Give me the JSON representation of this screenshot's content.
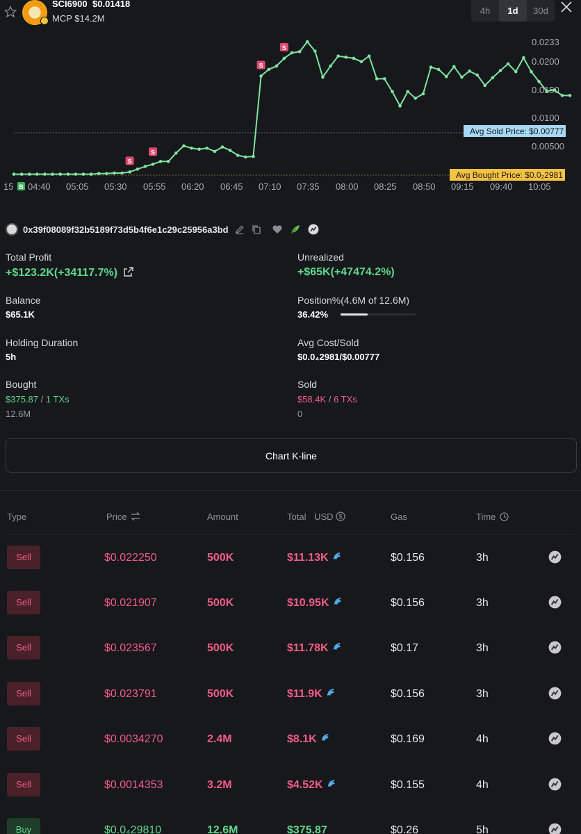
{
  "header": {
    "token_name": "SCI6900",
    "token_price": "$0.01418",
    "mcp": "MCP $14.2M",
    "timeframes": [
      "4h",
      "1d",
      "30d"
    ],
    "active_timeframe": "1d"
  },
  "chart_data": {
    "type": "line",
    "x_ticks": [
      "15",
      "04:40",
      "05:05",
      "05:30",
      "05:55",
      "06:20",
      "06:45",
      "07:10",
      "07:35",
      "08:00",
      "08:25",
      "08:50",
      "09:15",
      "09:40",
      "10:05"
    ],
    "y_ticks": [
      "0.0233",
      "0.0200",
      "0.0150",
      "0.0100",
      "0.00500"
    ],
    "series": [
      {
        "values": [
          0.0003,
          0.0003,
          0.0003,
          0.0003,
          0.0003,
          0.0003,
          0.0003,
          0.0003,
          0.0003,
          0.0003,
          0.0003,
          0.0004,
          0.0004,
          0.0005,
          0.0005,
          0.0007,
          0.0012,
          0.0017,
          0.0021,
          0.0026,
          0.0026,
          0.0041,
          0.0054,
          0.005,
          0.0048,
          0.005,
          0.0044,
          0.0052,
          0.0046,
          0.0037,
          0.0034,
          0.0035,
          0.018,
          0.0192,
          0.0198,
          0.0212,
          0.0222,
          0.0224,
          0.0242,
          0.0225,
          0.0178,
          0.0198,
          0.0216,
          0.0214,
          0.0212,
          0.0206,
          0.0216,
          0.0175,
          0.0175,
          0.0152,
          0.0126,
          0.0152,
          0.014,
          0.0148,
          0.0196,
          0.0192,
          0.0179,
          0.0197,
          0.0178,
          0.0189,
          0.0182,
          0.0163,
          0.0177,
          0.019,
          0.0202,
          0.0188,
          0.0213,
          0.0188,
          0.017,
          0.0153,
          0.0155,
          0.0145,
          0.0145
        ]
      }
    ],
    "sell_markers": [
      "S",
      "S",
      "S",
      "S"
    ],
    "buy_marker": "B",
    "avg_sold_label": "Avg Sold Price: $0.00777",
    "avg_bought_label": "Avg Bought Price: $0.0₂2981",
    "avg_sold_value": 0.00777,
    "avg_bought_value": 0.0003
  },
  "wallet": {
    "address": "0x39f08089f32b5189f73d5b4f6e1c29c25956a3bd"
  },
  "stats": {
    "total_profit_label": "Total Profit",
    "total_profit": "+$123.2K(+34117.7%)",
    "unrealized_label": "Unrealized",
    "unrealized": "+$65K(+47474.2%)",
    "balance_label": "Balance",
    "balance": "$65.1K",
    "position_label": "Position%(4.6M of 12.6M)",
    "position": "36.42%",
    "position_fraction": 0.3642,
    "holding_label": "Holding Duration",
    "holding": "5h",
    "avg_cost_label": "Avg Cost/Sold",
    "avg_cost": "$0.0₄2981/$0.00777",
    "bought_label": "Bought",
    "bought_usd": "$375.87",
    "bought_sep": "/",
    "bought_txs": "1 TXs",
    "bought_amount": "12.6M",
    "sold_label": "Sold",
    "sold_usd": "$58.4K",
    "sold_sep": "/",
    "sold_txs": "6 TXs",
    "sold_amount": "0"
  },
  "kline_button": "Chart K-line",
  "table": {
    "headers": {
      "type": "Type",
      "price": "Price",
      "amount": "Amount",
      "total": "Total",
      "usd": "USD",
      "gas": "Gas",
      "time": "Time"
    },
    "rows": [
      {
        "type": "Sell",
        "price": "$0.022250",
        "amount": "500K",
        "total": "$11.13K",
        "gas": "$0.156",
        "time": "3h"
      },
      {
        "type": "Sell",
        "price": "$0.021907",
        "amount": "500K",
        "total": "$10.95K",
        "gas": "$0.156",
        "time": "3h"
      },
      {
        "type": "Sell",
        "price": "$0.023567",
        "amount": "500K",
        "total": "$11.78K",
        "gas": "$0.17",
        "time": "3h"
      },
      {
        "type": "Sell",
        "price": "$0.023791",
        "amount": "500K",
        "total": "$11.9K",
        "gas": "$0.156",
        "time": "3h"
      },
      {
        "type": "Sell",
        "price": "$0.0034270",
        "amount": "2.4M",
        "total": "$8.1K",
        "gas": "$0.169",
        "time": "4h"
      },
      {
        "type": "Sell",
        "price": "$0.0014353",
        "amount": "3.2M",
        "total": "$4.52K",
        "gas": "$0.155",
        "time": "4h"
      },
      {
        "type": "Buy",
        "price": "$0.0₄29810",
        "amount": "12.6M",
        "total": "$375.87",
        "gas": "$0.26",
        "time": "5h"
      }
    ]
  },
  "colors": {
    "green": "#5fd98a",
    "red": "#f25c86",
    "background": "#17181c",
    "sold_tag": "#a6d8f5",
    "bought_tag": "#f5c242"
  }
}
